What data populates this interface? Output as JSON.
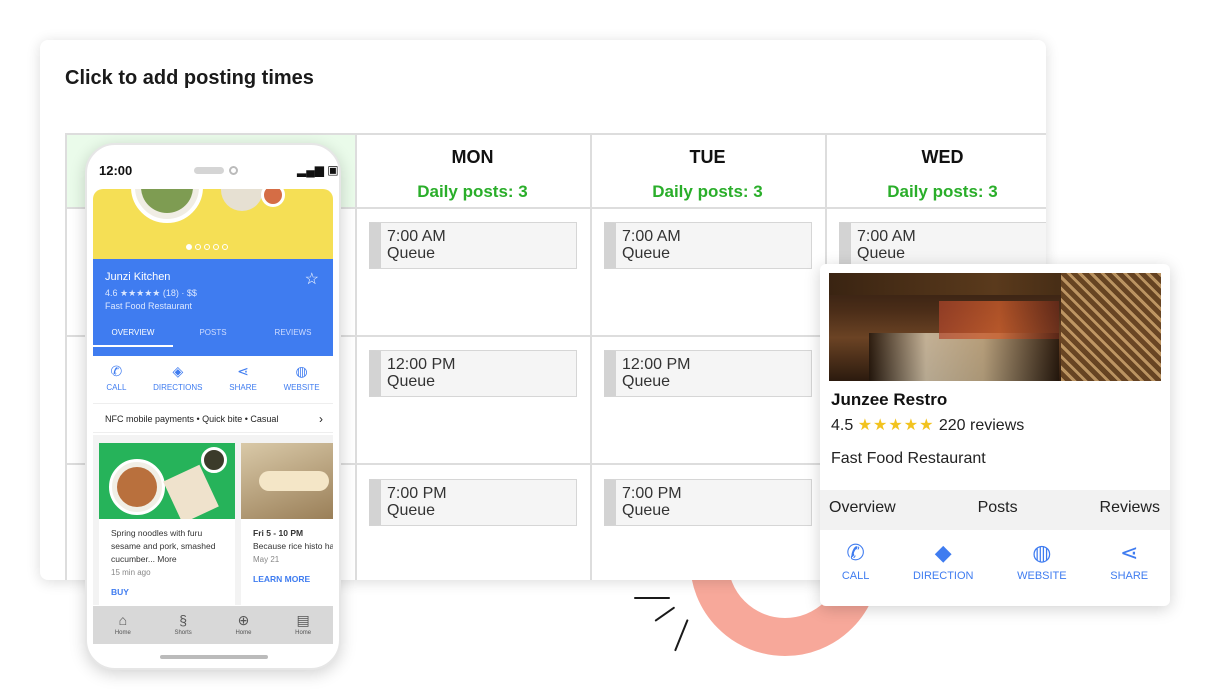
{
  "scheduler": {
    "title": "Click to add posting times",
    "days": [
      {
        "name": "MON",
        "posts": "Daily posts: 3",
        "slots": [
          {
            "time": "7:00 AM",
            "status": "Queue"
          },
          {
            "time": "12:00 PM",
            "status": "Queue"
          },
          {
            "time": "7:00 PM",
            "status": "Queue"
          }
        ]
      },
      {
        "name": "TUE",
        "posts": "Daily posts: 3",
        "slots": [
          {
            "time": "7:00 AM",
            "status": "Queue"
          },
          {
            "time": "12:00 PM",
            "status": "Queue"
          },
          {
            "time": "7:00 PM",
            "status": "Queue"
          }
        ]
      },
      {
        "name": "WED",
        "posts": "Daily posts: 3",
        "slots": [
          {
            "time": "7:00 AM",
            "status": "Queue"
          }
        ]
      }
    ]
  },
  "phone": {
    "time": "12:00",
    "business": {
      "name": "Junzi Kitchen",
      "rating": "4.6 ★★★★★ (18) · $$",
      "type": "Fast Food Restaurant"
    },
    "tabs": [
      "OVERVIEW",
      "POSTS",
      "REVIEWS"
    ],
    "actions": [
      {
        "icon": "phone-icon",
        "label": "CALL"
      },
      {
        "icon": "directions-icon",
        "label": "DIRECTIONS"
      },
      {
        "icon": "share-icon",
        "label": "SHARE"
      },
      {
        "icon": "globe-icon",
        "label": "WEBSITE"
      }
    ],
    "attributes": "NFC mobile payments • Quick bite • Casual",
    "posts": [
      {
        "text": "Spring noodles with furu sesame and pork, smashed cucumber... More",
        "meta": "15 min ago",
        "link": "BUY"
      },
      {
        "text_title": "Fri 5 - 10 PM",
        "text": "Because rice histo hasn't grown well",
        "meta": "May 21",
        "link": "LEARN MORE"
      }
    ],
    "bottom_nav": [
      {
        "icon": "home-icon",
        "label": "Home"
      },
      {
        "icon": "shorts-icon",
        "label": "Shorts"
      },
      {
        "icon": "add-icon",
        "label": "Home"
      },
      {
        "icon": "library-icon",
        "label": "Home"
      }
    ]
  },
  "restaurant": {
    "name": "Junzee Restro",
    "rating": "4.5",
    "stars": "★★★★★",
    "reviews": "220 reviews",
    "type": "Fast Food Restaurant",
    "tabs": [
      "Overview",
      "Posts",
      "Reviews"
    ],
    "actions": [
      {
        "icon": "phone-icon",
        "label": "CALL"
      },
      {
        "icon": "direction-icon",
        "label": "DIRECTION"
      },
      {
        "icon": "globe-icon",
        "label": "WEBSITE"
      },
      {
        "icon": "share-icon",
        "label": "SHARE"
      }
    ]
  },
  "colors": {
    "accent_green": "#2aae2a",
    "accent_blue": "#3f7cf0",
    "star_yellow": "#f2c31f",
    "donut": "#f7a89a"
  }
}
